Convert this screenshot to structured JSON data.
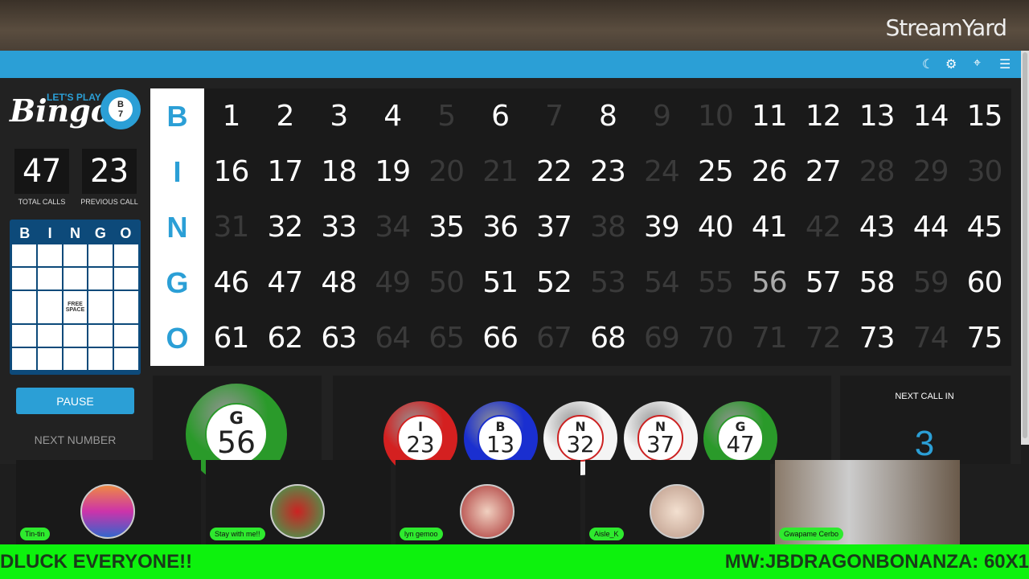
{
  "brand": "StreamYard",
  "toolbar_icons": [
    "moon-icon",
    "gears-icon",
    "map-pin-icon",
    "menu-icon"
  ],
  "logo": {
    "tagline": "LET'S PLAY",
    "word": "Bingo!",
    "ball_letter": "B",
    "ball_number": "7"
  },
  "stats": {
    "total_calls": "47",
    "total_calls_label": "TOTAL CALLS",
    "previous_call": "23",
    "previous_call_label": "PREVIOUS CALL"
  },
  "card": {
    "letters": [
      "B",
      "I",
      "N",
      "G",
      "O"
    ],
    "free_space": "FREE SPACE"
  },
  "pause_label": "PAUSE",
  "next_number_label": "NEXT NUMBER",
  "board": {
    "letters": [
      "B",
      "I",
      "N",
      "G",
      "O"
    ],
    "called": [
      1,
      2,
      3,
      4,
      6,
      8,
      11,
      12,
      13,
      14,
      15,
      16,
      17,
      18,
      19,
      22,
      23,
      25,
      26,
      27,
      32,
      33,
      35,
      36,
      37,
      39,
      40,
      41,
      43,
      44,
      45,
      46,
      47,
      48,
      51,
      52,
      56,
      57,
      58,
      60,
      61,
      62,
      63,
      66,
      68,
      73,
      75
    ],
    "current": 56
  },
  "current_ball": {
    "letter": "G",
    "number": "56",
    "color": "#2a9a2a"
  },
  "recent_balls": [
    {
      "letter": "I",
      "number": "23",
      "color": "#d42020"
    },
    {
      "letter": "B",
      "number": "13",
      "color": "#1a2fd0"
    },
    {
      "letter": "N",
      "number": "32",
      "color": "#f4f4f4"
    },
    {
      "letter": "N",
      "number": "37",
      "color": "#f4f4f4"
    },
    {
      "letter": "G",
      "number": "47",
      "color": "#2a9a2a"
    }
  ],
  "next_call": {
    "label": "NEXT CALL IN",
    "value": "3"
  },
  "participants": [
    {
      "name": "Tin-tin"
    },
    {
      "name": "Stay with me!!"
    },
    {
      "name": "lyn gemoo"
    },
    {
      "name": "Aisle_K"
    },
    {
      "name": "Gwapame Cerbo"
    }
  ],
  "ticker": {
    "left": "DLUCK EVERYONE!!",
    "right": "MW:JBDRAGONBONANZA: 60X1"
  }
}
